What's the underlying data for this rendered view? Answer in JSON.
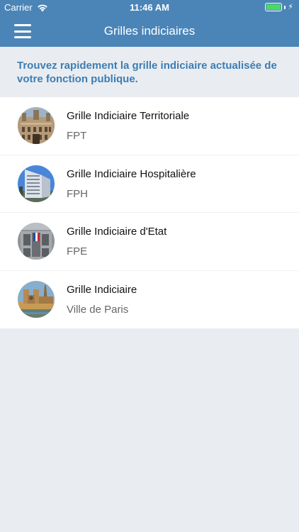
{
  "status_bar": {
    "carrier": "Carrier",
    "time": "11:46 AM",
    "battery_color": "#4cd964"
  },
  "header": {
    "title": "Grilles indiciaires",
    "background": "#4b85b8",
    "menu_icon": "hamburger-icon"
  },
  "intro": {
    "text": "Trouvez rapidement la grille indiciaire actualisée de votre fonction publique.",
    "color": "#3d7db4"
  },
  "items": [
    {
      "title": "Grille Indiciaire Territoriale",
      "subtitle": "FPT",
      "image": "city-hall-photo"
    },
    {
      "title": "Grille Indiciaire Hospitalière",
      "subtitle": "FPH",
      "image": "hospital-photo"
    },
    {
      "title": "Grille Indiciaire d'Etat",
      "subtitle": "FPE",
      "image": "state-building-photo"
    },
    {
      "title": "Grille Indiciaire",
      "subtitle": "Ville de Paris",
      "image": "notre-dame-photo"
    }
  ]
}
